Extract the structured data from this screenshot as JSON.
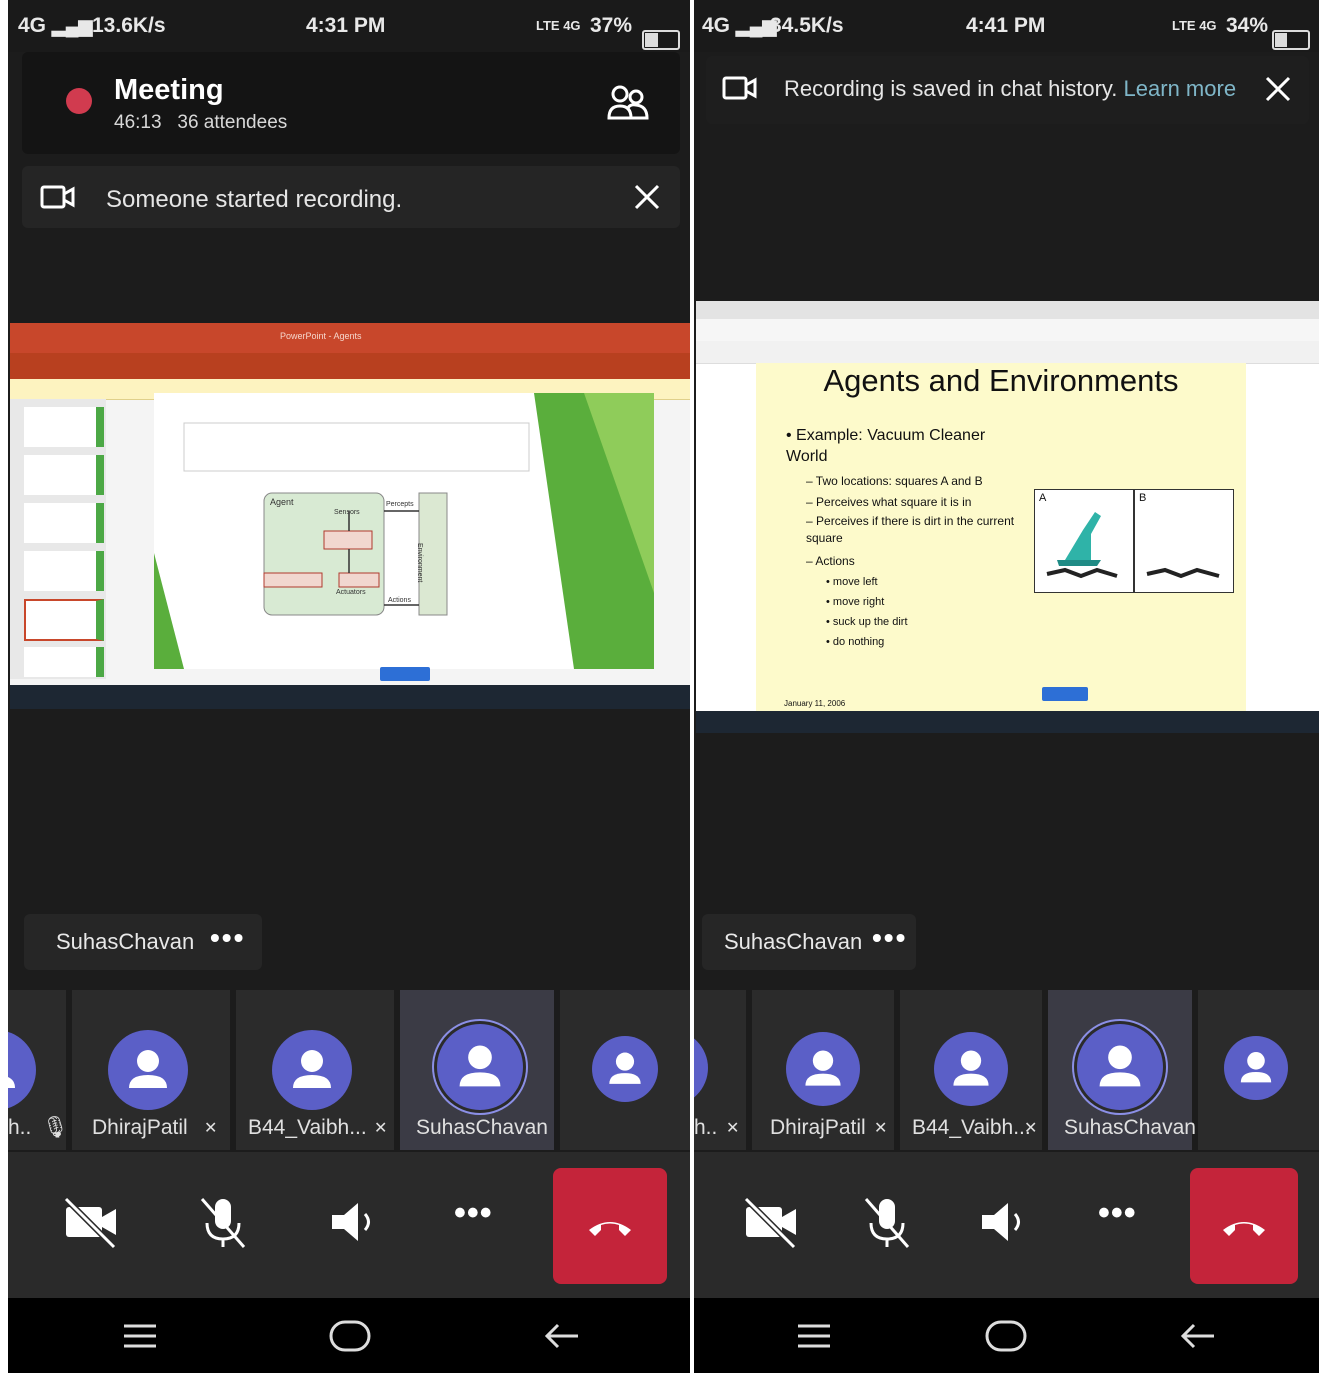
{
  "left": {
    "status": {
      "network": "4G",
      "speed": "13.6K/s",
      "time": "4:31 PM",
      "volte": "LTE 4G",
      "battery": "37%",
      "battery_level": 0.37
    },
    "meeting": {
      "title": "Meeting",
      "duration": "46:13",
      "attendees": "36 attendees"
    },
    "notice": {
      "text": "Someone started recording."
    },
    "shared": {
      "app_header": "PowerPoint - Agents",
      "slide_labels": [
        "Agent",
        "Sensors",
        "Percepts",
        "Actuators",
        "Actions",
        "Environment"
      ]
    },
    "speaker": {
      "name": "SuhasChavan"
    },
    "participants": [
      {
        "label": "h..",
        "muted": true
      },
      {
        "label": "DhirajPatil",
        "muted": true
      },
      {
        "label": "B44_Vaibh...",
        "muted": true
      },
      {
        "label": "SuhasChavan",
        "muted": false,
        "active": true
      },
      {
        "label": "",
        "muted": false
      }
    ]
  },
  "right": {
    "status": {
      "network": "4G",
      "speed": "34.5K/s",
      "time": "4:41 PM",
      "volte": "LTE 4G",
      "battery": "34%",
      "battery_level": 0.34
    },
    "notice": {
      "text": "Recording is saved in chat history.",
      "link": "Learn more"
    },
    "slide": {
      "title": "Agents and Environments",
      "bullet": "Example: Vacuum Cleaner World",
      "sub": [
        "Two locations: squares A and B",
        "Perceives what square it is in",
        "Perceives if there is dirt in the current square",
        "Actions"
      ],
      "actions": [
        "move left",
        "move right",
        "suck up the dirt",
        "do nothing"
      ],
      "box_labels": [
        "A",
        "B"
      ],
      "footer": "January 11, 2006"
    },
    "speaker": {
      "name": "SuhasChavan"
    },
    "participants": [
      {
        "label": "h..",
        "muted": true
      },
      {
        "label": "DhirajPatil",
        "muted": true
      },
      {
        "label": "B44_Vaibh...",
        "muted": true
      },
      {
        "label": "SuhasChavan",
        "muted": false,
        "active": true
      },
      {
        "label": "",
        "muted": false
      }
    ]
  },
  "colors": {
    "avatar": "#5b5fc7",
    "hangup": "#c4243a",
    "recording": "#d13b4f",
    "link": "#7fb6c8"
  }
}
